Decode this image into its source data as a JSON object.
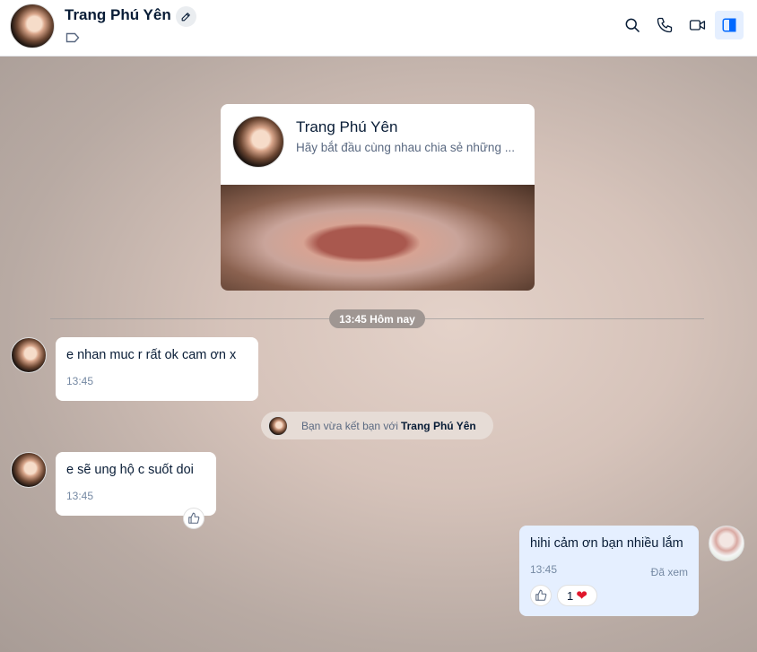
{
  "header": {
    "contact_name": "Trang Phú Yên",
    "icons": [
      "edit-icon",
      "tag-icon",
      "search-icon",
      "phone-icon",
      "video-icon",
      "sidebar-toggle-icon"
    ]
  },
  "profile_card": {
    "name": "Trang Phú Yên",
    "description": "Hãy bắt đầu cùng nhau chia sẻ những ..."
  },
  "divider": {
    "label": "13:45 Hôm nay"
  },
  "messages": [
    {
      "text": "e nhan  muc  r rất ok cam ơn x",
      "time": "13:45"
    },
    {
      "text": "e sẽ  ung hộ  c suốt doi",
      "time": "13:45"
    }
  ],
  "notice": {
    "prefix": "Bạn vừa kết bạn với",
    "name": "Trang Phú Yên"
  },
  "my_message": {
    "text": "hihi cảm ơn bạn nhiều lắm",
    "time": "13:45",
    "status": "Đã xem",
    "reaction_count": "1"
  },
  "colors": {
    "accent": "#0068ff",
    "my_bubble": "#e5efff",
    "heart": "#e0172c"
  }
}
